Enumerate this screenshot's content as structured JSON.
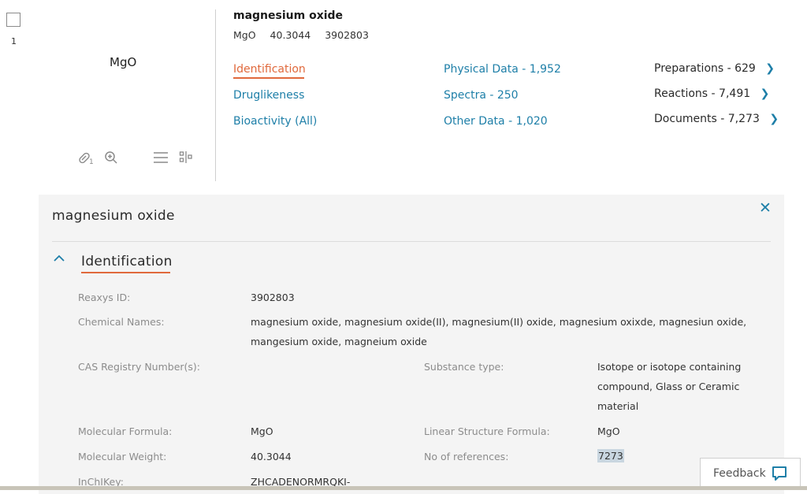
{
  "row": {
    "number": "1",
    "structure_formula": "MgO"
  },
  "substance": {
    "name": "magnesium oxide",
    "formula": "MgO",
    "weight": "40.3044",
    "reaxys_id": "3902803"
  },
  "links": {
    "col1": [
      "Identification",
      "Druglikeness",
      "Bioactivity (All)"
    ],
    "col2": [
      "Physical Data - 1,952",
      "Spectra - 250",
      "Other Data - 1,020"
    ],
    "col3": [
      "Preparations - 629",
      "Reactions - 7,491",
      "Documents - 7,273"
    ]
  },
  "panel": {
    "title": "magnesium oxide",
    "section": "Identification",
    "fields": {
      "reaxys_id_label": "Reaxys ID:",
      "reaxys_id_value": "3902803",
      "chem_names_label": "Chemical Names:",
      "chem_names_line1": "magnesium oxide, magnesium oxide(II), magnesium(II) oxide, magnesium oxixde, magnesiun oxide,",
      "chem_names_line2": "mangesium oxide, magneium oxide",
      "cas_label": "CAS Registry Number(s):",
      "subst_type_label": "Substance type:",
      "subst_type_line1": "Isotope or isotope containing",
      "subst_type_line2": "compound, Glass or Ceramic",
      "subst_type_line3": "material",
      "mol_formula_label": "Molecular Formula:",
      "mol_formula_value": "MgO",
      "linear_formula_label": "Linear Structure Formula:",
      "linear_formula_value": "MgO",
      "mol_weight_label": "Molecular Weight:",
      "mol_weight_value": "40.3044",
      "refs_label": "No of references:",
      "refs_value": "7273",
      "inchikey_label": "InChIKey:",
      "inchikey_value": "ZHCADENORMRQKI-"
    }
  },
  "feedback": {
    "label": "Feedback"
  },
  "icons": {
    "link_count": "1"
  },
  "colors": {
    "link": "#1e7fa8",
    "active": "#e0693c",
    "panel_bg": "#f4f4f4"
  }
}
